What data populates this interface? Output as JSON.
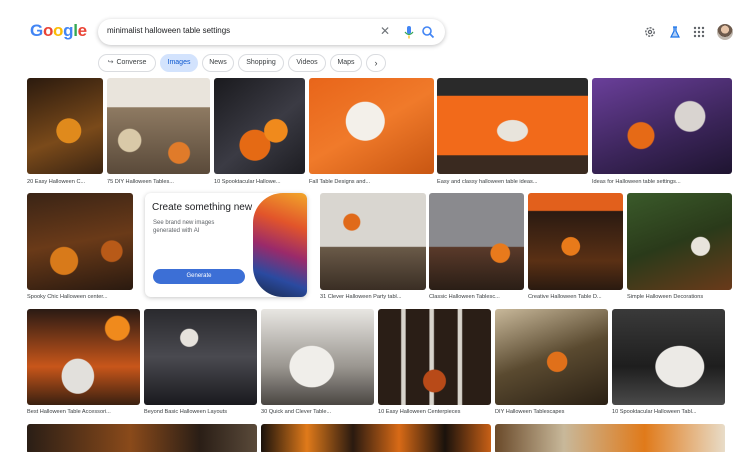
{
  "logo": {
    "text": "Google",
    "letters": [
      "G",
      "o",
      "o",
      "g",
      "l",
      "e"
    ],
    "colors": [
      "#4285f4",
      "#ea4335",
      "#fbbc05",
      "#4285f4",
      "#34a853",
      "#ea4335"
    ]
  },
  "search": {
    "query": "minimalist halloween table settings"
  },
  "icons": {
    "clear": "close-icon",
    "voice": "mic-icon",
    "lens": "search-icon",
    "settings": "gear-icon",
    "labs": "flask-icon",
    "apps": "apps-grid-icon"
  },
  "chips": [
    {
      "label": "Converse",
      "icon": "↪"
    },
    {
      "label": "Images"
    },
    {
      "label": "News"
    },
    {
      "label": "Shopping"
    },
    {
      "label": "Videos"
    },
    {
      "label": "Maps"
    },
    {
      "label": "›"
    }
  ],
  "promo": {
    "title": "Create something new",
    "subtitle": "See brand new images generated with AI",
    "button": "Generate"
  },
  "results": [
    {
      "caption": "20 Easy Halloween C..."
    },
    {
      "caption": "75 DIY Halloween Tables..."
    },
    {
      "caption": "10 Spooktacular Hallowe..."
    },
    {
      "caption": "Fall Table Designs and..."
    },
    {
      "caption": "Easy and classy halloween table ideas..."
    },
    {
      "caption": "Ideas for Halloween table settings..."
    },
    {
      "caption": "Spooky Chic Halloween center..."
    },
    {
      "caption": "31 Clever Halloween Party tabl..."
    },
    {
      "caption": "Classic Halloween Tablesc..."
    },
    {
      "caption": "Creative Halloween Table D..."
    },
    {
      "caption": "Simple Halloween Decorations"
    },
    {
      "caption": "Best Halloween Table Accessori..."
    },
    {
      "caption": "Beyond Basic Halloween Layouts"
    },
    {
      "caption": "30 Quick and Clever Table..."
    },
    {
      "caption": "10 Easy Halloween Centerpieces"
    },
    {
      "caption": "DIY Halloween Tablescapes"
    },
    {
      "caption": "10 Spooktacular Halloween Tabl..."
    }
  ]
}
